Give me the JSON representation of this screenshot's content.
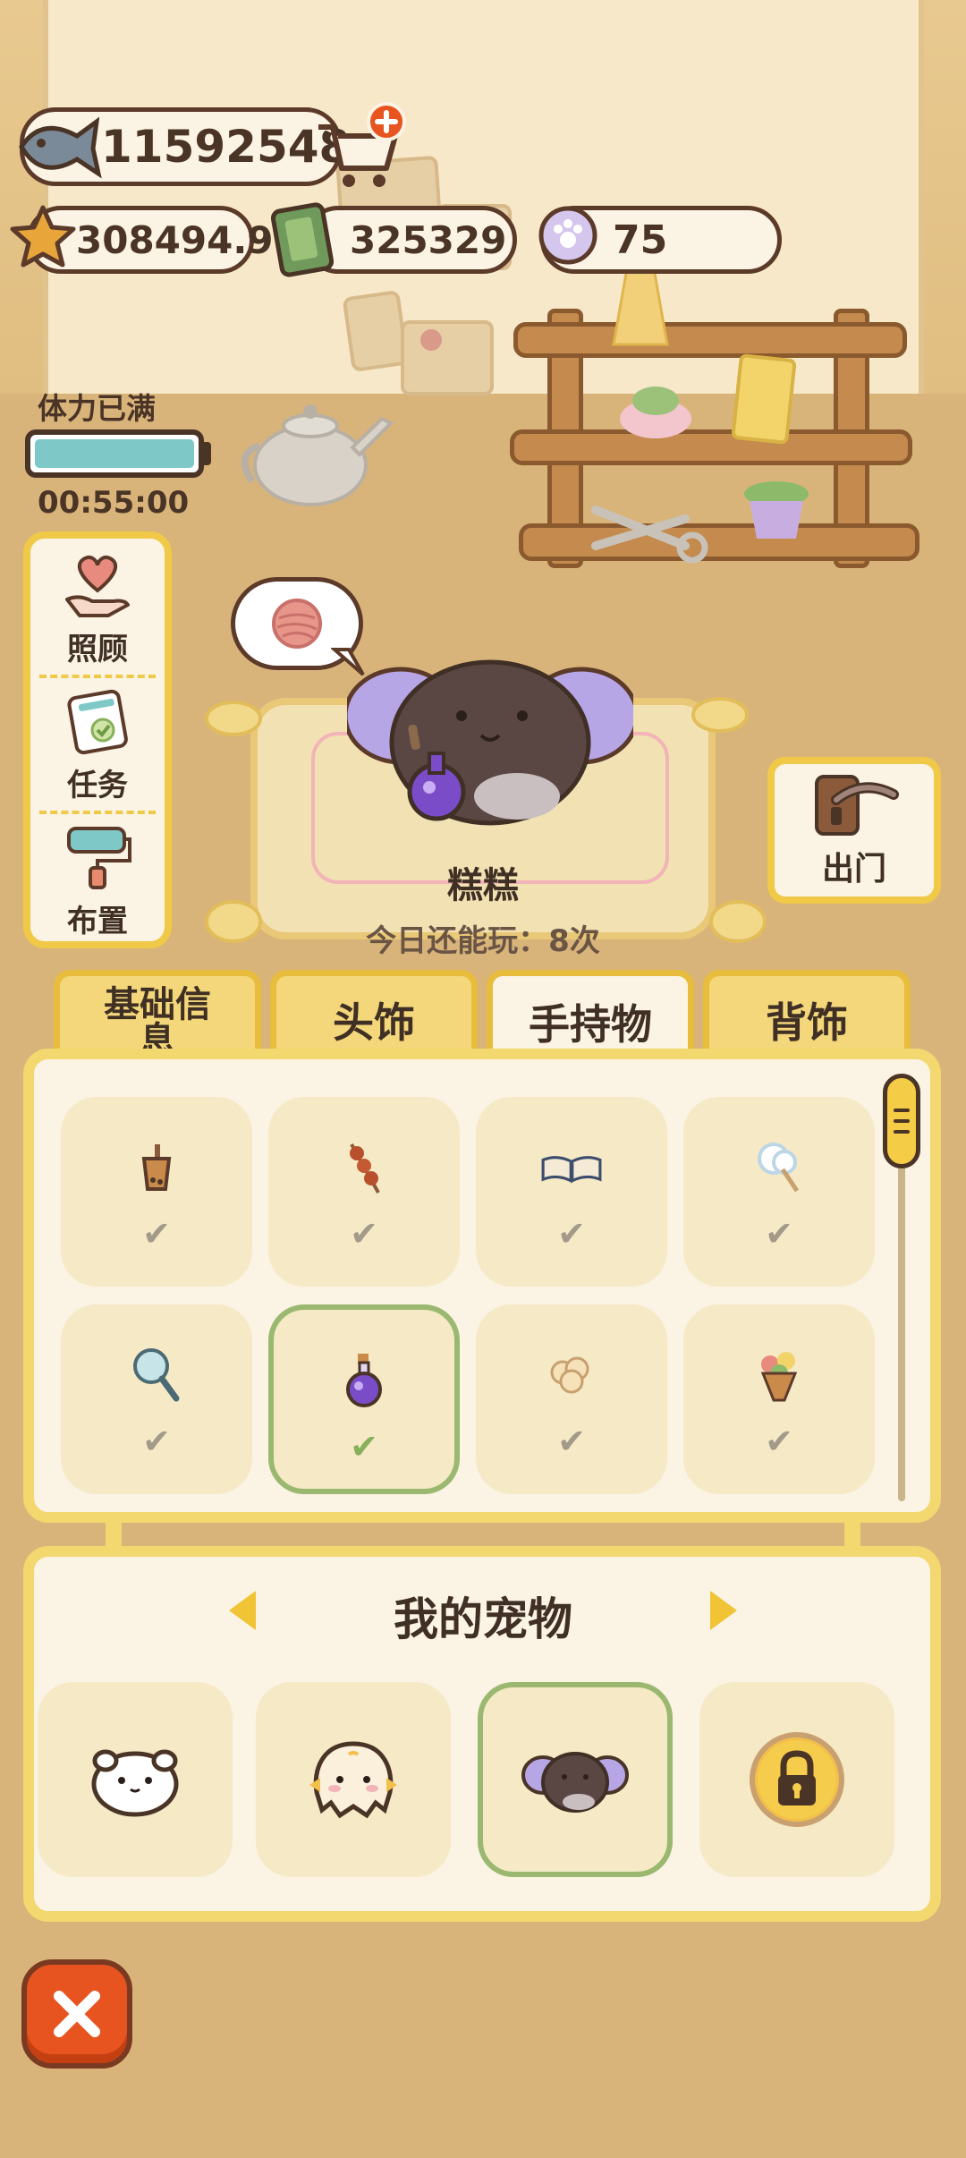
{
  "currency": {
    "fish": "11592548",
    "star": "308494.9",
    "cash": "325329",
    "paw": "75"
  },
  "stamina": {
    "status": "体力已满",
    "timer": "00:55:00",
    "level": 1.0
  },
  "side_menu": {
    "items": [
      {
        "label": "照顾",
        "icon": "heart-hand-icon"
      },
      {
        "label": "任务",
        "icon": "task-list-icon"
      },
      {
        "label": "布置",
        "icon": "paint-roller-icon"
      }
    ]
  },
  "pet": {
    "name": "糕糕",
    "play_count": "今日还能玩：8次",
    "thought_icon": "yarn-ball-icon"
  },
  "go_out": {
    "label": "出门",
    "icon": "door-handle-icon"
  },
  "tabs": [
    {
      "label": "基础信\n息",
      "active": false
    },
    {
      "label": "头饰",
      "active": false
    },
    {
      "label": "手持物",
      "active": true
    },
    {
      "label": "背饰",
      "active": false
    }
  ],
  "items": [
    {
      "icon": "bubble-tea-icon",
      "owned": true,
      "selected": false
    },
    {
      "icon": "skewer-icon",
      "owned": true,
      "selected": false
    },
    {
      "icon": "open-book-icon",
      "owned": true,
      "selected": false
    },
    {
      "icon": "cotton-candy-icon",
      "owned": true,
      "selected": false
    },
    {
      "icon": "hand-mirror-icon",
      "owned": true,
      "selected": false
    },
    {
      "icon": "potion-bottle-icon",
      "owned": true,
      "selected": true
    },
    {
      "icon": "popcorn-icon",
      "owned": true,
      "selected": false
    },
    {
      "icon": "bouquet-icon",
      "owned": true,
      "selected": false
    }
  ],
  "my_pets": {
    "title": "我的宠物",
    "pets": [
      {
        "icon": "white-seal-icon",
        "selected": false,
        "locked": false
      },
      {
        "icon": "cream-chick-icon",
        "selected": false,
        "locked": false
      },
      {
        "icon": "elephant-icon",
        "selected": true,
        "locked": false
      },
      {
        "icon": "lock-icon",
        "selected": false,
        "locked": true
      }
    ]
  },
  "colors": {
    "accent_yellow": "#f3d76f",
    "panel_bg": "#fbf3e4",
    "selected_green": "#9ab86f",
    "close_orange": "#e8541f",
    "stamina_teal": "#7ec8c8"
  }
}
